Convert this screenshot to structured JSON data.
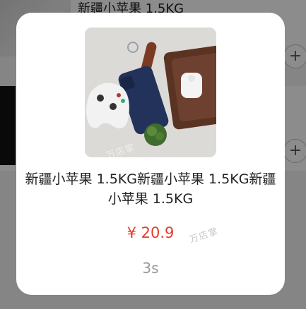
{
  "background": {
    "rows": [
      {
        "title": "新疆小苹果 1.5KG",
        "add_label": "+"
      },
      {
        "title": "",
        "add_label": "+"
      }
    ]
  },
  "modal": {
    "image_icon": "product-photo",
    "watermark_image": "万店掌",
    "title": "新疆小苹果 1.5KG新疆小苹果 1.5KG新疆小苹果 1.5KG",
    "price": "¥ 20.9",
    "watermark_price": "万店掌",
    "countdown": "3s"
  },
  "colors": {
    "price": "#e53c2b",
    "countdown": "#999999",
    "overlay": "rgba(0,0,0,0.45)"
  }
}
